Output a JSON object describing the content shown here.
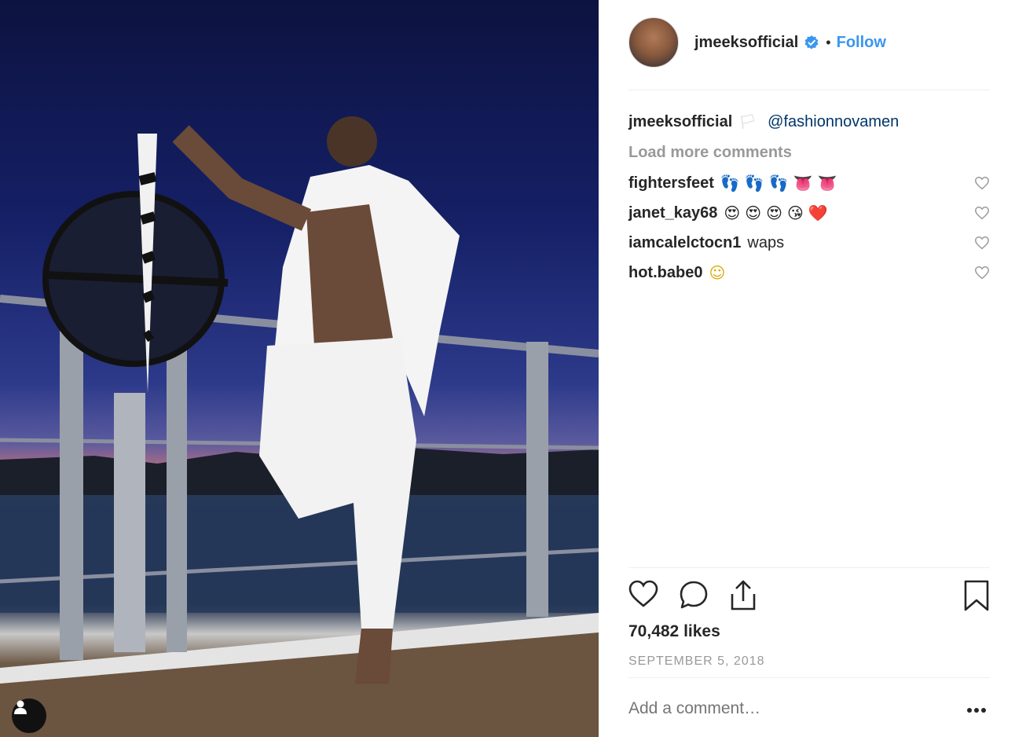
{
  "post": {
    "username": "jmeeksofficial",
    "follow_label": "Follow",
    "separator": "•",
    "caption_user": "jmeeksofficial",
    "caption_flag": "🏳",
    "caption_mention": "@fashionnovamen",
    "load_more_label": "Load more comments",
    "comments": [
      {
        "user": "fightersfeet",
        "text": "👣👣👣👅👅"
      },
      {
        "user": "janet_kay68",
        "text": "😍😍😍😘❤️"
      },
      {
        "user": "iamcalelctocn1",
        "text": "waps"
      },
      {
        "user": "hot.babe0",
        "text": "☺"
      }
    ],
    "likes": "70,482 likes",
    "date": "SEPTEMBER 5, 2018",
    "add_comment_placeholder": "Add a comment…",
    "more_label": "•••"
  },
  "icons": {
    "verified": "verified-badge-icon",
    "like": "heart-icon",
    "comment": "comment-bubble-icon",
    "share": "share-icon",
    "save": "bookmark-icon",
    "user_tags": "user-tag-icon",
    "more": "more-options-icon"
  },
  "colors": {
    "accent": "#3897f0",
    "mention": "#003569",
    "muted": "#999999",
    "text": "#262626"
  }
}
